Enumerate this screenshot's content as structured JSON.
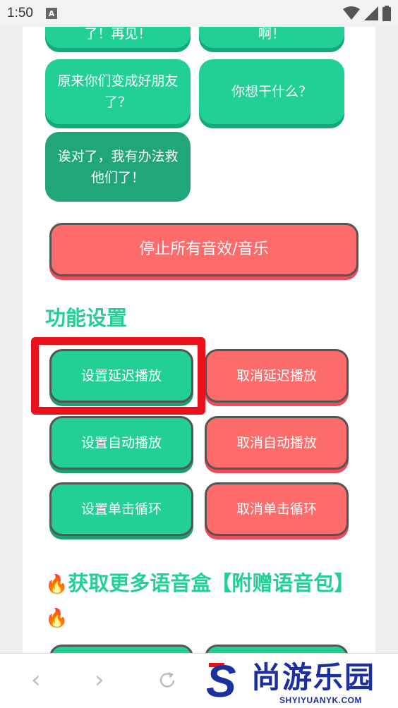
{
  "status_bar": {
    "time": "1:50",
    "notification_icon_letter": "A"
  },
  "sound_buttons": [
    {
      "label": "了！再见！"
    },
    {
      "label": "啊！"
    },
    {
      "label": "原来你们变成好朋友了？"
    },
    {
      "label": "你想干什么？"
    },
    {
      "label": "诶对了，我有办法救他们了！"
    }
  ],
  "stop_all_button": {
    "label": "停止所有音效/音乐"
  },
  "settings": {
    "title": "功能设置",
    "set_delay": "设置延迟播放",
    "cancel_delay": "取消延迟播放",
    "set_auto": "设置自动播放",
    "cancel_auto": "取消自动播放",
    "set_loop": "设置单击循环",
    "cancel_loop": "取消单击循环"
  },
  "more": {
    "title": "获取更多语音盒【附赠语音包】"
  },
  "watermark": {
    "letter": "S",
    "chinese": "尚游乐园",
    "english": "SHYIYUANYK.COM"
  },
  "colors": {
    "green": "#22d097",
    "dark_green": "#21a57a",
    "red": "#fe6b6b",
    "highlight": "#e8111c",
    "logo_blue": "#1b2fa0"
  },
  "icons": {
    "back": "back-arrow-icon",
    "forward": "forward-arrow-icon",
    "reload": "reload-icon",
    "fire": "fire-emoji-icon",
    "wifi": "wifi-icon",
    "signal": "signal-icon",
    "battery": "battery-icon"
  }
}
